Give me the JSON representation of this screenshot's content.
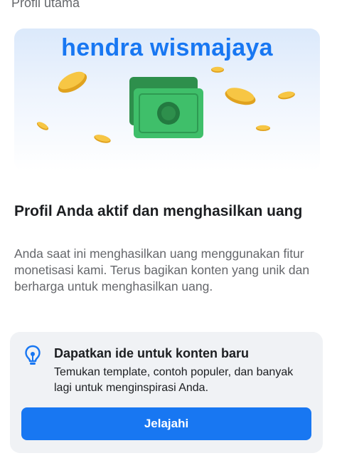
{
  "header": {
    "title": "Profil utama"
  },
  "banner": {
    "name": "hendra wismajaya",
    "illustration": "money-coins-illustration"
  },
  "status": {
    "headline": "Profil Anda aktif dan menghasilkan uang",
    "description": "Anda saat ini menghasilkan uang menggunakan fitur monetisasi kami. Terus bagikan konten yang unik dan berharga untuk menghasilkan uang."
  },
  "idea_card": {
    "icon": "lightbulb-icon",
    "title": "Dapatkan ide untuk konten baru",
    "description": "Temukan template, contoh populer, dan banyak lagi untuk menginspirasi Anda.",
    "button_label": "Jelajahi"
  },
  "colors": {
    "accent": "#1877f2",
    "coin": "#f5b82e",
    "money": "#3fbf6a"
  }
}
